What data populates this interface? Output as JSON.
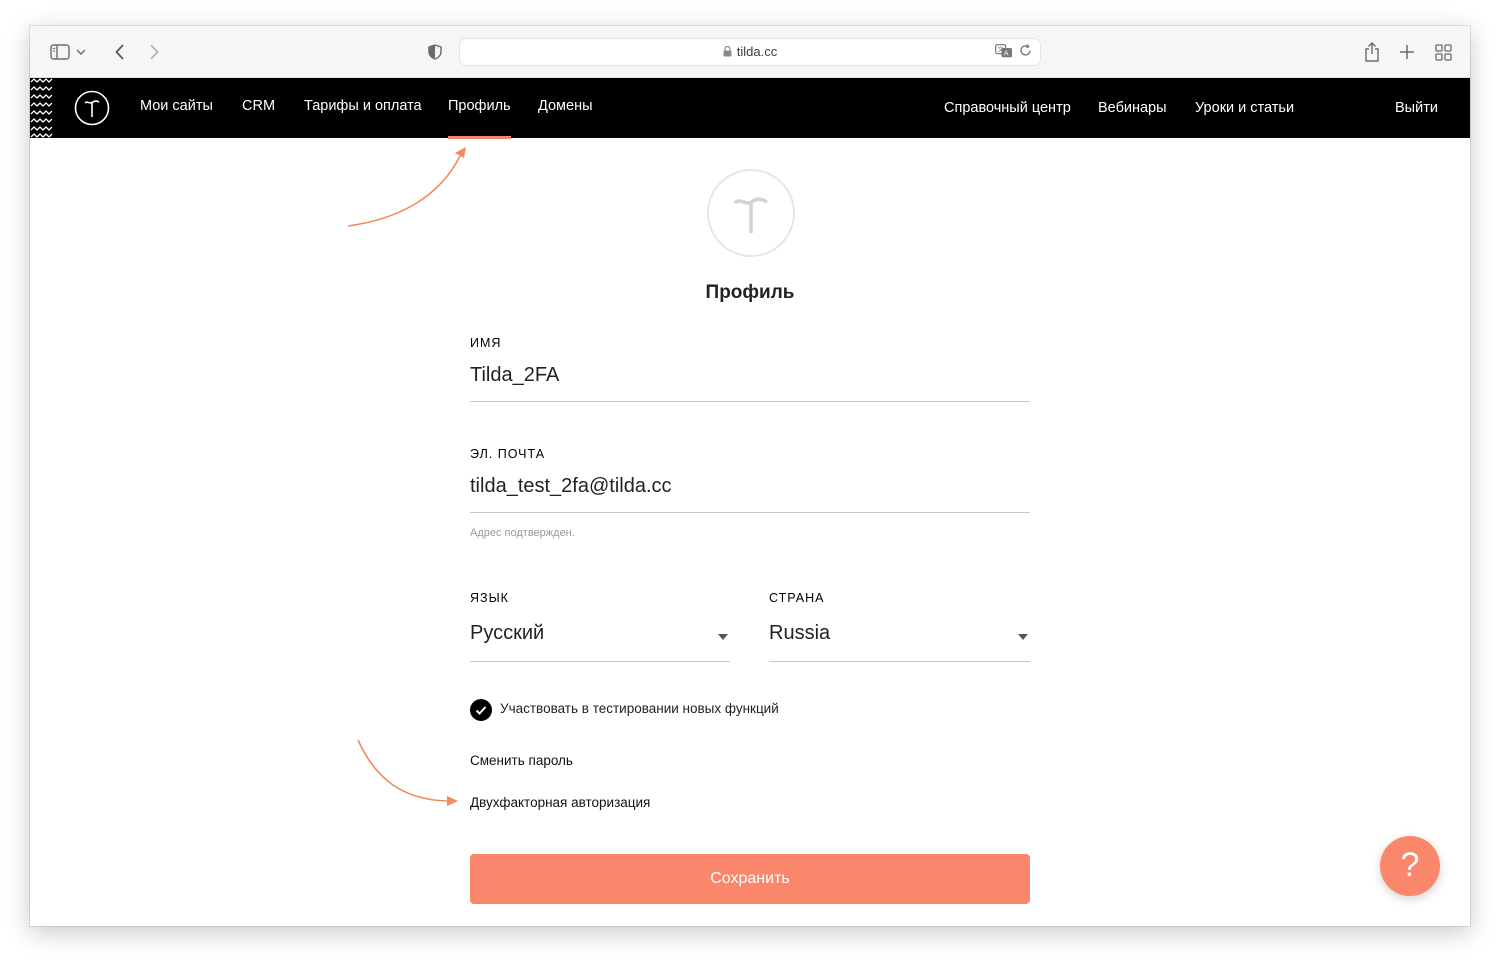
{
  "browser": {
    "url": "tilda.cc",
    "icons": [
      "sidebar-icon",
      "chevron-down-icon",
      "back-icon",
      "forward-icon",
      "shield-icon",
      "lock-icon",
      "translate-icon",
      "reload-icon",
      "share-icon",
      "plus-icon",
      "tabs-grid-icon"
    ]
  },
  "nav": {
    "logo": "tilda-logo",
    "items_left": [
      {
        "label": "Мои сайты"
      },
      {
        "label": "CRM"
      },
      {
        "label": "Тарифы и оплата"
      },
      {
        "label": "Профиль",
        "active": true
      },
      {
        "label": "Домены"
      }
    ],
    "items_right": [
      {
        "label": "Справочный центр"
      },
      {
        "label": "Вебинары"
      },
      {
        "label": "Уроки и статьи"
      }
    ],
    "logout": "Выйти"
  },
  "profile": {
    "title": "Профиль",
    "name_label": "ИМЯ",
    "name_value": "Tilda_2FA",
    "email_label": "ЭЛ. ПОЧТА",
    "email_value": "tilda_test_2fa@tilda.cc",
    "email_hint": "Адрес подтвержден.",
    "language_label": "ЯЗЫК",
    "language_value": "Русский",
    "country_label": "СТРАНА",
    "country_value": "Russia",
    "beta_checkbox_label": "Участвовать в тестировании новых функций",
    "beta_checked": true,
    "change_password": "Сменить пароль",
    "two_factor": "Двухфакторная авторизация",
    "save_label": "Сохранить"
  },
  "help": {
    "label": "?"
  },
  "colors": {
    "accent": "#fa876c",
    "nav_bg": "#000000",
    "active_underline": "#fa8669"
  }
}
